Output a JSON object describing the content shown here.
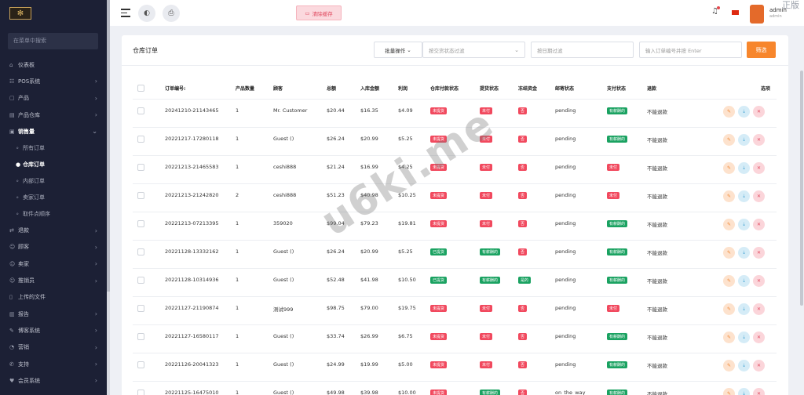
{
  "sidebar": {
    "search_placeholder": "在菜单中搜索",
    "menu": [
      {
        "icon": "⌂",
        "label": "仪表板",
        "chev": false,
        "open": false
      },
      {
        "icon": "☷",
        "label": "POS系统",
        "chev": true,
        "open": false
      },
      {
        "icon": "▢",
        "label": "产品",
        "chev": true,
        "open": false
      },
      {
        "icon": "▤",
        "label": "产品仓库",
        "chev": true,
        "open": false
      },
      {
        "icon": "▣",
        "label": "销售量",
        "chev": true,
        "open": true
      }
    ],
    "submenu": [
      {
        "label": "所有订单",
        "active": false
      },
      {
        "label": "仓库订单",
        "active": true
      },
      {
        "label": "内部订单",
        "active": false
      },
      {
        "label": "卖家订单",
        "active": false
      },
      {
        "label": "取件点顺序",
        "active": false
      }
    ],
    "menu2": [
      {
        "icon": "⇄",
        "label": "退款",
        "chev": true
      },
      {
        "icon": "☺",
        "label": "顾客",
        "chev": true
      },
      {
        "icon": "☺",
        "label": "卖家",
        "chev": true
      },
      {
        "icon": "☺",
        "label": "推销员",
        "chev": true
      },
      {
        "icon": "▯",
        "label": "上传的文件",
        "chev": false
      },
      {
        "icon": "▥",
        "label": "报告",
        "chev": true
      },
      {
        "icon": "✎",
        "label": "博客系统",
        "chev": true
      },
      {
        "icon": "◔",
        "label": "营销",
        "chev": true
      },
      {
        "icon": "✆",
        "label": "支持",
        "chev": true
      },
      {
        "icon": "♥",
        "label": "会员系统",
        "chev": true
      }
    ]
  },
  "topbar": {
    "clear_cache_label": "清除缓存",
    "admin_name": "admin",
    "admin_role": "admin",
    "corner_text": "正版"
  },
  "card": {
    "title": "仓库订单",
    "bulk_label": "批量操作",
    "delivery_filter_placeholder": "按交货状态过滤",
    "date_filter_placeholder": "按日期过滤",
    "order_search_placeholder": "输入订单编号并按 Enter",
    "filter_button": "筛选"
  },
  "table": {
    "headers": [
      "订单编号:",
      "产品数量",
      "顾客",
      "总额",
      "入库金额",
      "利润",
      "仓库付款状态",
      "提货状态",
      "冻结资金",
      "邮寄状态",
      "支付状态",
      "退款",
      "选项"
    ],
    "rows": [
      {
        "order": "20241210-21143465",
        "qty": "1",
        "customer": "Mr. Customer",
        "total": "$20.44",
        "in_amt": "$16.35",
        "profit": "$4.09",
        "wh_pay": {
          "text": "未提货",
          "color": "red"
        },
        "pickup": {
          "text": "未付",
          "color": "red"
        },
        "frozen": {
          "text": "否",
          "color": "red"
        },
        "mail": "pending",
        "pay": {
          "text": "有薪酬的",
          "color": "green"
        },
        "refund": "不能退款"
      },
      {
        "order": "20221217-17280118",
        "qty": "1",
        "customer": "Guest ()",
        "total": "$26.24",
        "in_amt": "$20.99",
        "profit": "$5.25",
        "wh_pay": {
          "text": "未提货",
          "color": "red"
        },
        "pickup": {
          "text": "未付",
          "color": "red"
        },
        "frozen": {
          "text": "否",
          "color": "red"
        },
        "mail": "pending",
        "pay": {
          "text": "有薪酬的",
          "color": "green"
        },
        "refund": "不能退款"
      },
      {
        "order": "20221213-21465583",
        "qty": "1",
        "customer": "ceshi888",
        "total": "$21.24",
        "in_amt": "$16.99",
        "profit": "$4.25",
        "wh_pay": {
          "text": "未提货",
          "color": "red"
        },
        "pickup": {
          "text": "未付",
          "color": "red"
        },
        "frozen": {
          "text": "否",
          "color": "red"
        },
        "mail": "pending",
        "pay": {
          "text": "未付",
          "color": "red"
        },
        "refund": "不能退款"
      },
      {
        "order": "20221213-21242820",
        "qty": "2",
        "customer": "ceshi888",
        "total": "$51.23",
        "in_amt": "$40.98",
        "profit": "$10.25",
        "wh_pay": {
          "text": "未提货",
          "color": "red"
        },
        "pickup": {
          "text": "未付",
          "color": "red"
        },
        "frozen": {
          "text": "否",
          "color": "red"
        },
        "mail": "pending",
        "pay": {
          "text": "未付",
          "color": "red"
        },
        "refund": "不能退款"
      },
      {
        "order": "20221213-07213395",
        "qty": "1",
        "customer": "359020",
        "total": "$99.04",
        "in_amt": "$79.23",
        "profit": "$19.81",
        "wh_pay": {
          "text": "未提货",
          "color": "red"
        },
        "pickup": {
          "text": "未付",
          "color": "red"
        },
        "frozen": {
          "text": "否",
          "color": "red"
        },
        "mail": "pending",
        "pay": {
          "text": "有薪酬的",
          "color": "green"
        },
        "refund": "不能退款"
      },
      {
        "order": "20221128-13332162",
        "qty": "1",
        "customer": "Guest ()",
        "total": "$26.24",
        "in_amt": "$20.99",
        "profit": "$5.25",
        "wh_pay": {
          "text": "已提货",
          "color": "green"
        },
        "pickup": {
          "text": "有薪酬的",
          "color": "green"
        },
        "frozen": {
          "text": "否",
          "color": "red"
        },
        "mail": "pending",
        "pay": {
          "text": "有薪酬的",
          "color": "green"
        },
        "refund": "不能退款"
      },
      {
        "order": "20221128-10314936",
        "qty": "1",
        "customer": "Guest ()",
        "total": "$52.48",
        "in_amt": "$41.98",
        "profit": "$10.50",
        "wh_pay": {
          "text": "已提货",
          "color": "green"
        },
        "pickup": {
          "text": "有薪酬的",
          "color": "green"
        },
        "frozen": {
          "text": "是的",
          "color": "green"
        },
        "mail": "pending",
        "pay": {
          "text": "有薪酬的",
          "color": "green"
        },
        "refund": "不能退款"
      },
      {
        "order": "20221127-21190874",
        "qty": "1",
        "customer": "测试999",
        "total": "$98.75",
        "in_amt": "$79.00",
        "profit": "$19.75",
        "wh_pay": {
          "text": "未提货",
          "color": "red"
        },
        "pickup": {
          "text": "未付",
          "color": "red"
        },
        "frozen": {
          "text": "否",
          "color": "red"
        },
        "mail": "pending",
        "pay": {
          "text": "未付",
          "color": "red"
        },
        "refund": "不能退款"
      },
      {
        "order": "20221127-16580117",
        "qty": "1",
        "customer": "Guest ()",
        "total": "$33.74",
        "in_amt": "$26.99",
        "profit": "$6.75",
        "wh_pay": {
          "text": "未提货",
          "color": "red"
        },
        "pickup": {
          "text": "未付",
          "color": "red"
        },
        "frozen": {
          "text": "否",
          "color": "red"
        },
        "mail": "pending",
        "pay": {
          "text": "有薪酬的",
          "color": "green"
        },
        "refund": "不能退款"
      },
      {
        "order": "20221126-20041323",
        "qty": "1",
        "customer": "Guest ()",
        "total": "$24.99",
        "in_amt": "$19.99",
        "profit": "$5.00",
        "wh_pay": {
          "text": "未提货",
          "color": "red"
        },
        "pickup": {
          "text": "未付",
          "color": "red"
        },
        "frozen": {
          "text": "否",
          "color": "red"
        },
        "mail": "pending",
        "pay": {
          "text": "有薪酬的",
          "color": "green"
        },
        "refund": "不能退款"
      },
      {
        "order": "20221125-16475010",
        "qty": "1",
        "customer": "Guest ()",
        "total": "$49.98",
        "in_amt": "$39.98",
        "profit": "$10.00",
        "wh_pay": {
          "text": "未提货",
          "color": "red"
        },
        "pickup": {
          "text": "有薪酬的",
          "color": "green"
        },
        "frozen": {
          "text": "否",
          "color": "red"
        },
        "mail": "on_the_way",
        "pay": {
          "text": "有薪酬的",
          "color": "green"
        },
        "refund": "不能退款"
      }
    ]
  },
  "watermark": "u6ki.me"
}
